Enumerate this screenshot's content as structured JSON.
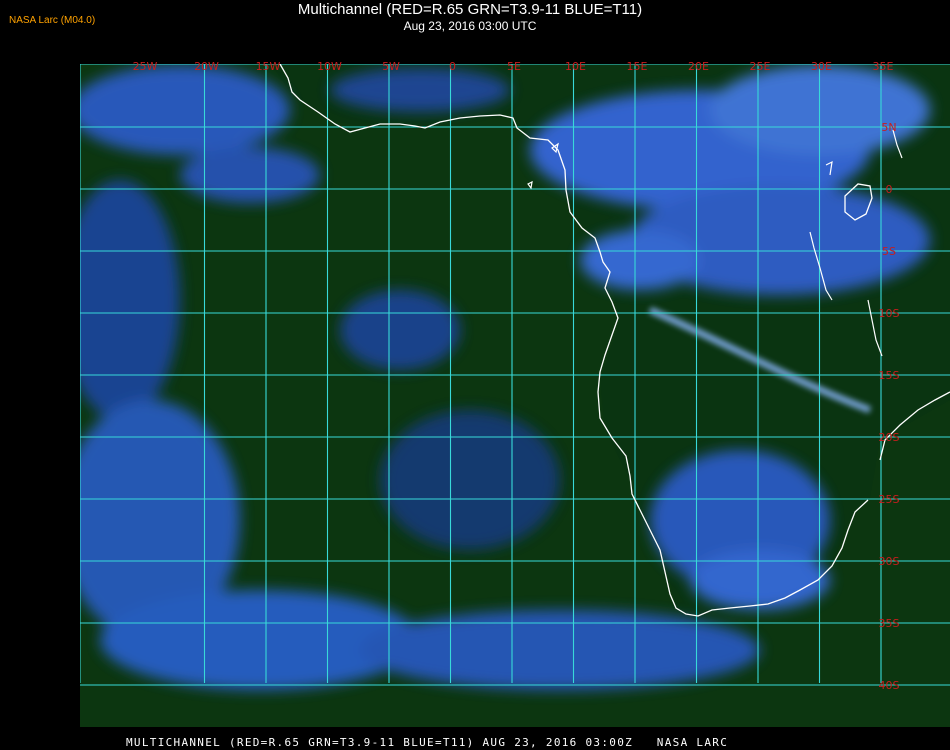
{
  "header": {
    "credit": "NASA Larc (M04.0)",
    "title": "Multichannel (RED=R.65 GRN=T3.9-11 BLUE=T11)",
    "subtitle": "Aug 23, 2016 03:00 UTC"
  },
  "map": {
    "longitude_labels": [
      "25W",
      "20W",
      "15W",
      "10W",
      "5W",
      "0",
      "5E",
      "10E",
      "15E",
      "20E",
      "25E",
      "30E",
      "35E"
    ],
    "latitude_labels": [
      "5N",
      "0",
      "5S",
      "10S",
      "15S",
      "20S",
      "25S",
      "30S",
      "35S",
      "40S"
    ],
    "colors": {
      "grid": "#38d9d9",
      "label": "#c81e1e",
      "coast": "#ffffff",
      "ocean": "#0d3a10",
      "cloud": "#3a6cf0",
      "bright_cloud": "#6fa6ff"
    }
  },
  "footer": "MULTICHANNEL (RED=R.65 GRN=T3.9-11 BLUE=T11) AUG 23, 2016 03:00Z   NASA LARC"
}
